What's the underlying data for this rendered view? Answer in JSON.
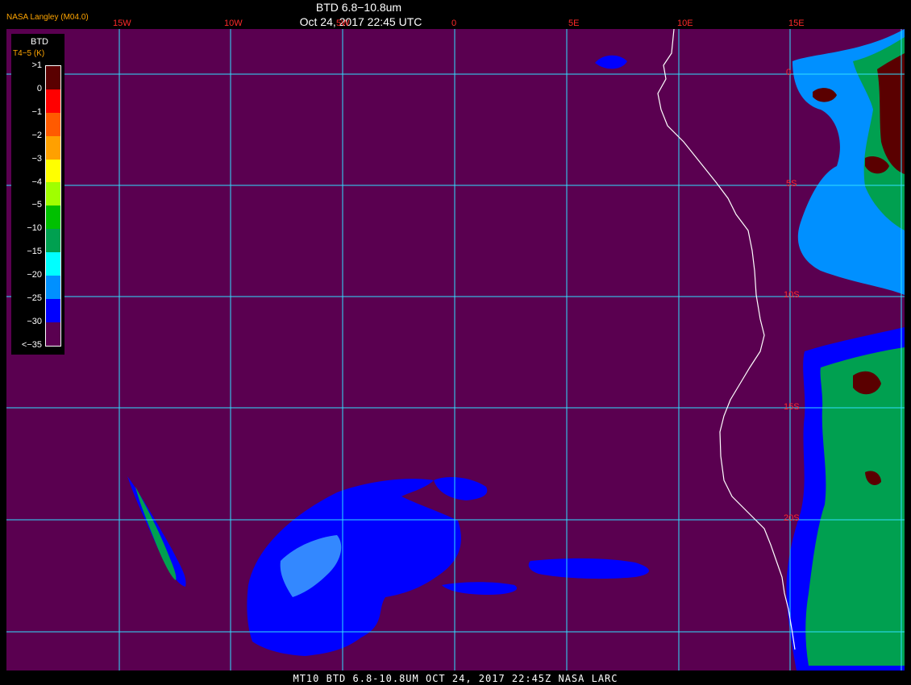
{
  "header": {
    "org": "NASA Langley (M04.0)",
    "title": "BTD 6.8−10.8um",
    "time": "Oct 24, 2017 22:45 UTC"
  },
  "footer": "MT10   BTD 6.8-10.8UM   OCT 24, 2017 22:45Z   NASA LARC",
  "longitudes": [
    "15W",
    "10W",
    "5W",
    "0",
    "5E",
    "10E",
    "15E"
  ],
  "latitudes": [
    "0",
    "5S",
    "10S",
    "15S",
    "20S"
  ],
  "legend": {
    "title": "BTD",
    "subtitle": "T4−5 (K)",
    "ticks": [
      ">1",
      "0",
      "−1",
      "−2",
      "−3",
      "−4",
      "−5",
      "−10",
      "−15",
      "−20",
      "−25",
      "−30",
      "<−35"
    ],
    "colors": [
      "#5a0000",
      "#ff0000",
      "#ff5a00",
      "#ffa000",
      "#ffff00",
      "#a0ff00",
      "#00c000",
      "#00a050",
      "#00ffff",
      "#0090ff",
      "#0000ff",
      "#5a0050"
    ]
  },
  "colors": {
    "background": "#5a0050",
    "grid": "#30e0ff",
    "coast": "#ffffff",
    "cloud_cold": "#0000ff"
  }
}
